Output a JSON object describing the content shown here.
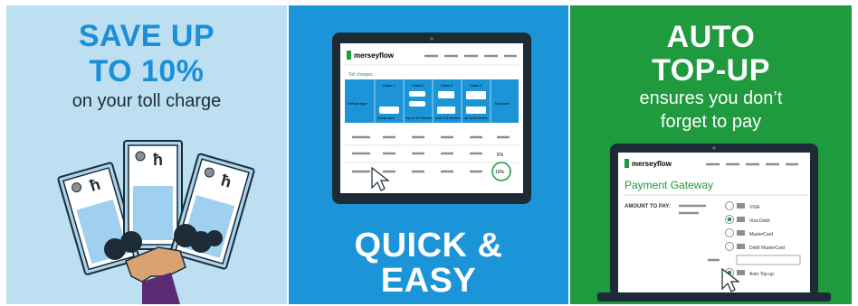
{
  "panel_savings": {
    "headline_line1": "SAVE UP",
    "headline_line2": "TO 10%",
    "subline": "on your toll charge",
    "currency_symbol": "ħ"
  },
  "panel_quick": {
    "headline_line1": "QUICK &",
    "headline_line2": "EASY",
    "tablet": {
      "brand": "merseyflow",
      "section_title": "Toll charges",
      "columns": [
        "Vehicle type",
        "Class 1",
        "Class 2",
        "Class 3",
        "Class 4",
        "Discount"
      ],
      "row_labels": [
        "Small cars",
        "up to 3.5 tonnes",
        "over 3.5 tonnes",
        "up to 8 tonnes"
      ],
      "discount_values": [
        "5%",
        "10%"
      ]
    }
  },
  "panel_autotopup": {
    "headline_line1": "AUTO",
    "headline_line2": "TOP-UP",
    "subline_1": "ensures you don’t",
    "subline_2": "forget to pay",
    "laptop": {
      "brand": "merseyflow",
      "page_title": "Payment Gateway",
      "amount_label": "AMOUNT TO PAY:",
      "payment_options": [
        "VISA",
        "Visa Debit",
        "MasterCard",
        "Debit MasterCard"
      ],
      "autotopup_label": "Auto Top-up"
    }
  },
  "colors": {
    "light_blue": "#bcdff2",
    "mid_blue": "#1b95d8",
    "green": "#1f9a3e",
    "headline_blue": "#1c8fd6"
  }
}
